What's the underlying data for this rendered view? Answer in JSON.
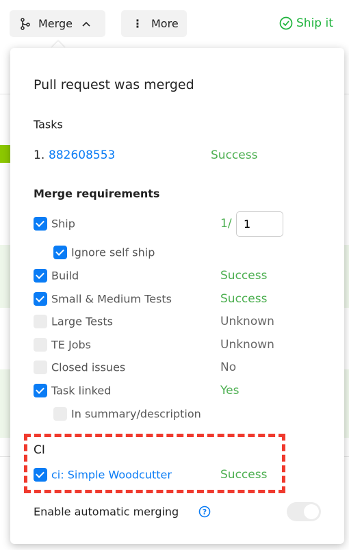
{
  "toolbar": {
    "merge_label": "Merge",
    "more_label": "More",
    "ship_label": "Ship it",
    "ship_color": "#1db33b"
  },
  "popup": {
    "title": "Pull request was merged",
    "tasks_heading": "Tasks",
    "tasks": [
      {
        "index": "1.",
        "id": "882608553",
        "status": "Success"
      }
    ],
    "requirements_heading": "Merge requirements",
    "ship": {
      "label": "Ship",
      "checked": true,
      "count_prefix": "1/",
      "required_value": "1"
    },
    "requirements": [
      {
        "label": "Ignore self ship",
        "checked": true,
        "status": ""
      },
      {
        "label": "Build",
        "checked": true,
        "status": "Success"
      },
      {
        "label": "Small & Medium Tests",
        "checked": true,
        "status": "Success"
      },
      {
        "label": "Large Tests",
        "checked": false,
        "status": "Unknown"
      },
      {
        "label": "TE Jobs",
        "checked": false,
        "status": "Unknown"
      },
      {
        "label": "Closed issues",
        "checked": false,
        "status": "No"
      },
      {
        "label": "Task linked",
        "checked": true,
        "status": "Yes"
      },
      {
        "label": "In summary/description",
        "checked": false,
        "status": ""
      }
    ],
    "ci_heading": "CI",
    "ci": {
      "label": "ci: Simple Woodcutter",
      "checked": true,
      "status": "Success"
    },
    "auto_merge_label": "Enable automatic merging",
    "auto_merge_enabled": true,
    "auto_merge_disabled": true
  },
  "colors": {
    "accent": "#0a7cf5",
    "success": "#4caf50",
    "highlight": "#f03a2e"
  }
}
